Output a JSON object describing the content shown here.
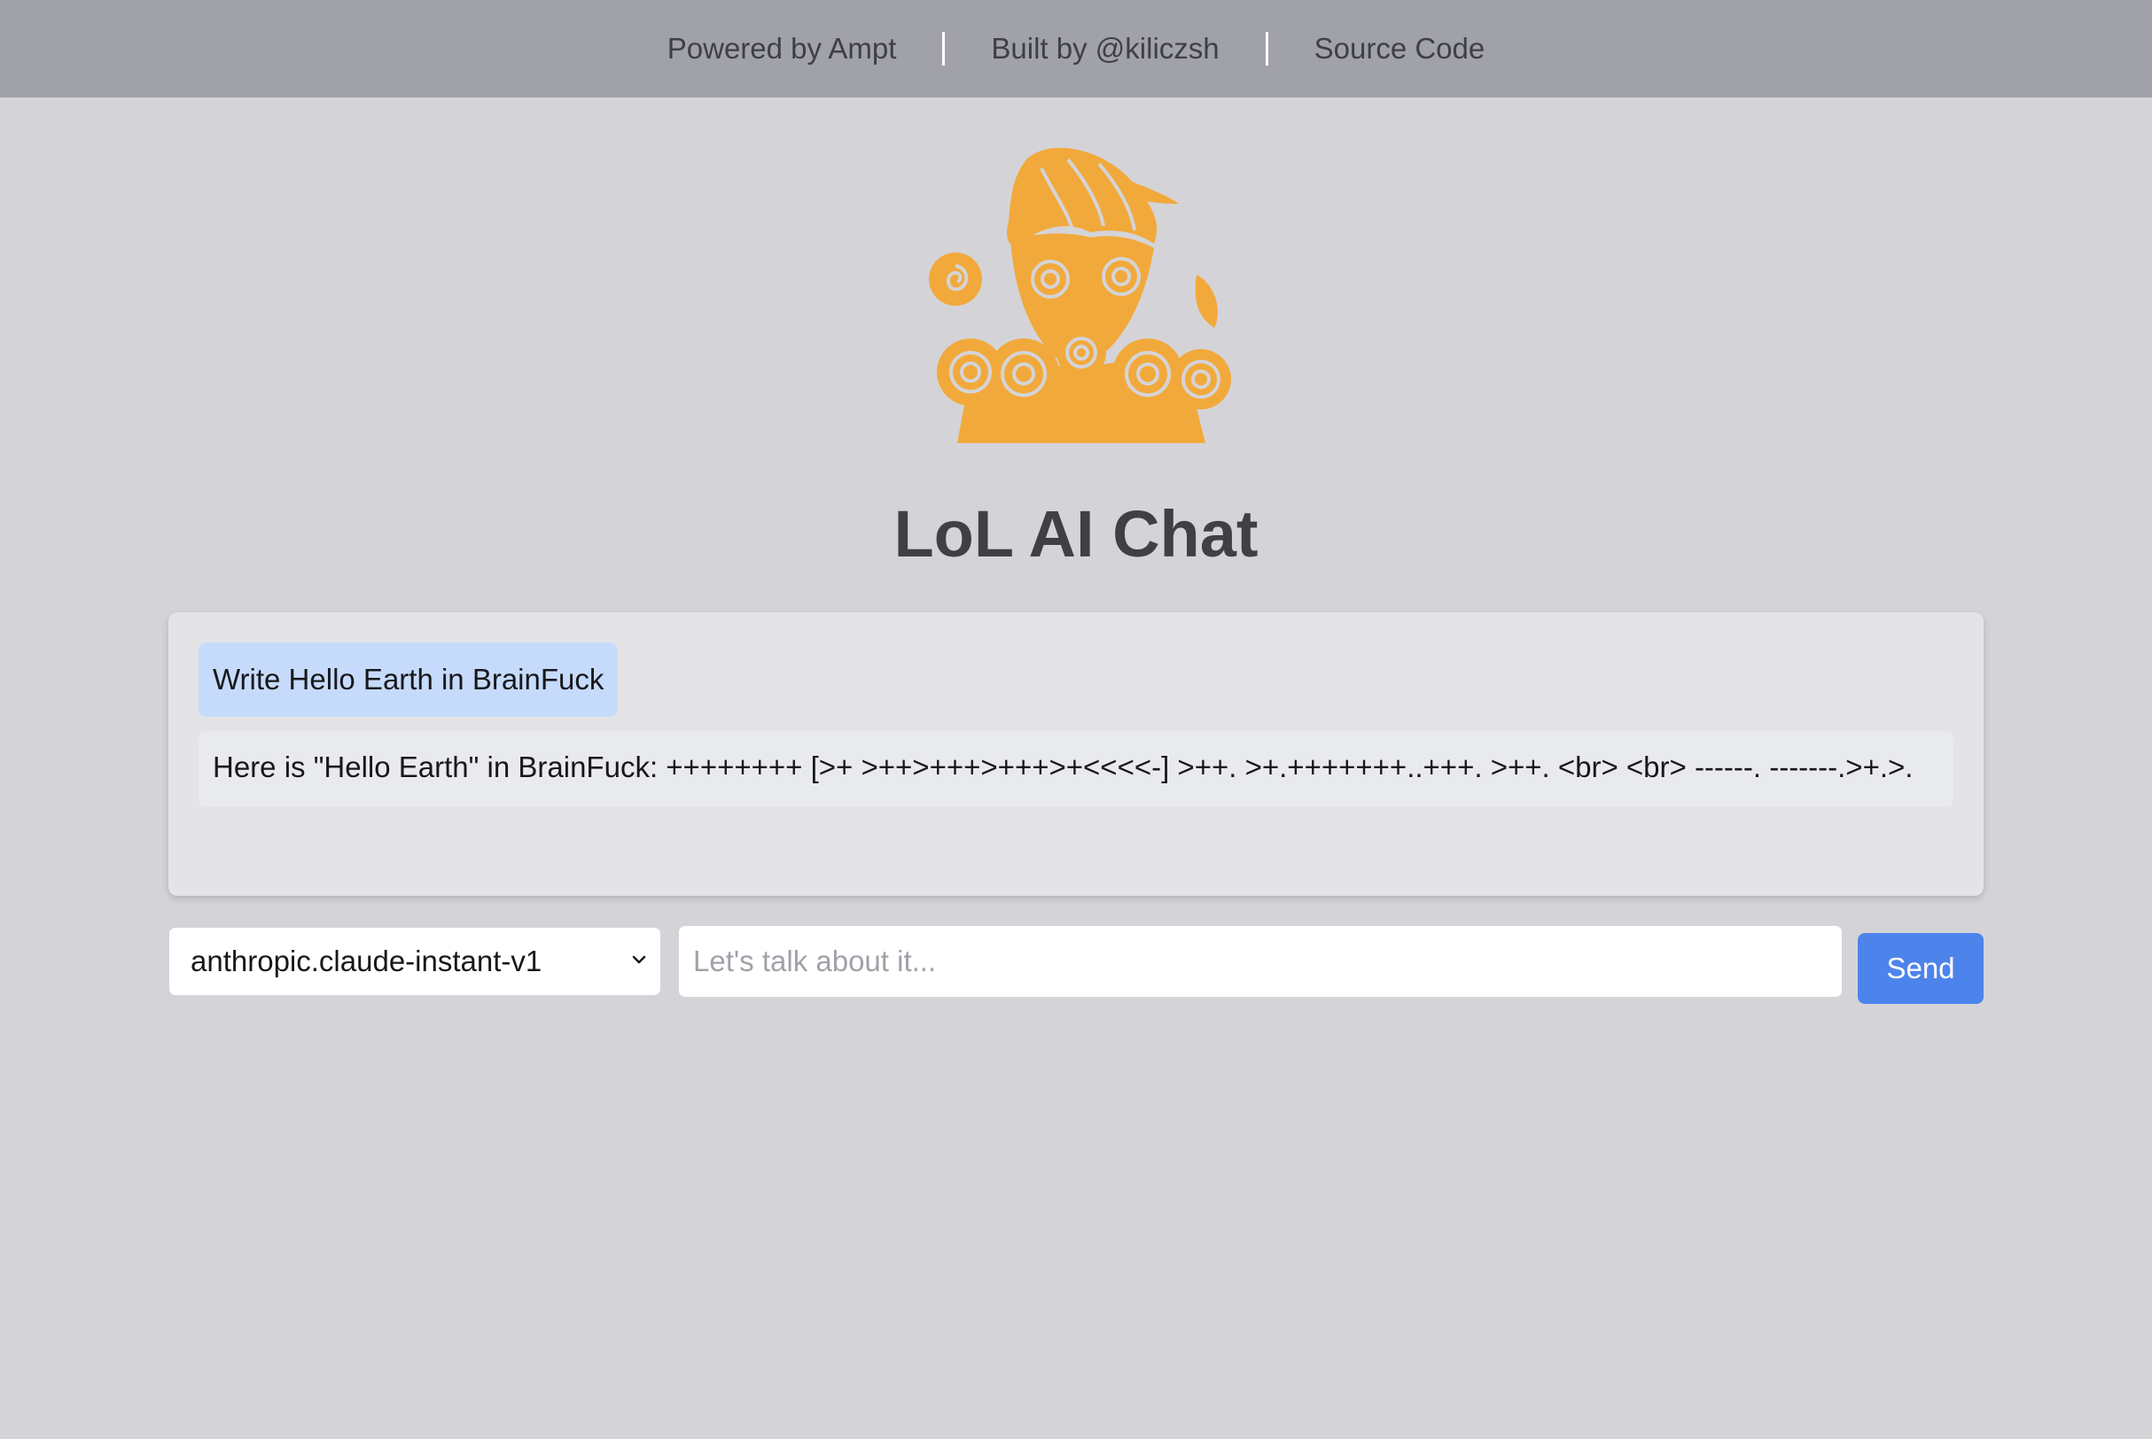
{
  "nav": {
    "links": [
      {
        "label": "Powered by Ampt"
      },
      {
        "label": "Built by @kiliczsh"
      },
      {
        "label": "Source Code"
      }
    ]
  },
  "brand": {
    "logo_icon": "orange-cartoon-girl-with-lollipops-logo",
    "accent_color": "#f2a93b"
  },
  "page": {
    "title": "LoL AI Chat"
  },
  "chat": {
    "messages": [
      {
        "role": "user",
        "text": "Write Hello Earth in BrainFuck"
      },
      {
        "role": "assistant",
        "text": "Here is \"Hello Earth\" in BrainFuck: ++++++++ [>+ >++>+++>+++>+<<<<-] >++. >+.+++++++..+++. >++. <br> <br> ------. -------.>+.>."
      }
    ]
  },
  "controls": {
    "model_selected": "anthropic.claude-instant-v1",
    "input_value": "",
    "input_placeholder": "Let's talk about it...",
    "send_label": "Send",
    "send_color": "#4d84ec"
  }
}
